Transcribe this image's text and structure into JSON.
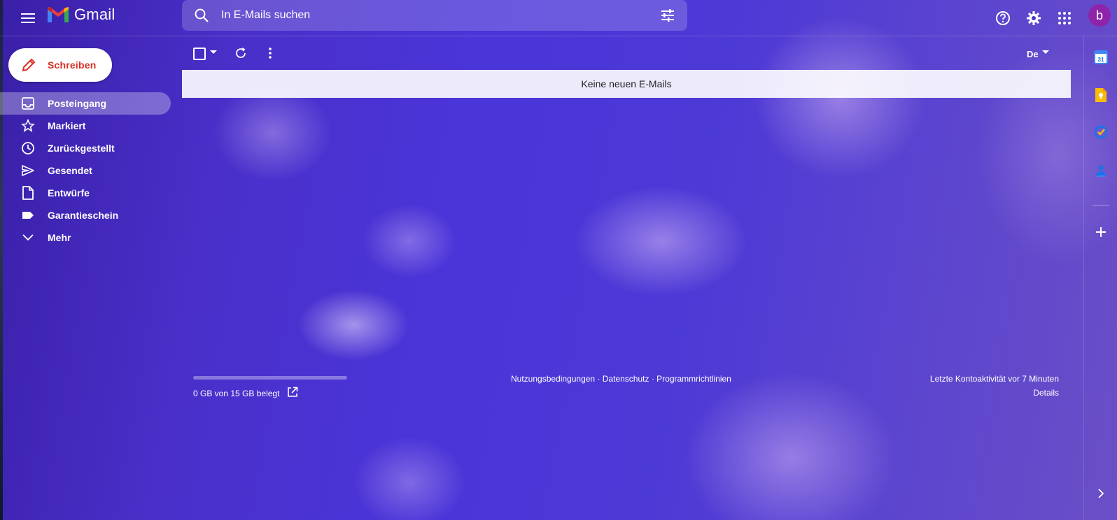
{
  "header": {
    "app_name": "Gmail",
    "search": {
      "placeholder": "In E-Mails suchen"
    },
    "avatar_letter": "b",
    "icons": [
      "menu-icon",
      "gmail-logo-icon",
      "search-icon",
      "filter-options-icon",
      "help-icon",
      "gear-icon",
      "apps-grid-icon"
    ]
  },
  "sidebar": {
    "compose_label": "Schreiben",
    "items": [
      {
        "label": "Posteingang",
        "icon": "inbox-icon",
        "active": true
      },
      {
        "label": "Markiert",
        "icon": "star-icon"
      },
      {
        "label": "Zurückgestellt",
        "icon": "clock-icon"
      },
      {
        "label": "Gesendet",
        "icon": "send-icon"
      },
      {
        "label": "Entwürfe",
        "icon": "draft-icon"
      },
      {
        "label": "Garantieschein",
        "icon": "label-icon"
      },
      {
        "label": "Mehr",
        "icon": "chevron-down-icon"
      }
    ]
  },
  "toolbar": {
    "language": "De"
  },
  "main": {
    "empty_message": "Keine neuen E-Mails"
  },
  "footer": {
    "storage_text": "0 GB von 15 GB belegt",
    "storage_used_fraction": 0.0,
    "links": [
      "Nutzungsbedingungen",
      "Datenschutz",
      "Programmrichtlinien"
    ],
    "separator": " · ",
    "activity": "Letzte Kontoaktivität vor 7 Minuten",
    "details": "Details"
  },
  "side_panel": {
    "calendar_day": "31",
    "icons": [
      "calendar-icon",
      "keep-icon",
      "tasks-icon",
      "contacts-icon",
      "add-icon",
      "chevron-right-icon"
    ]
  },
  "colors": {
    "compose_text": "#d93025",
    "avatar": "#8e24aa",
    "accent": "#4a35d8"
  }
}
